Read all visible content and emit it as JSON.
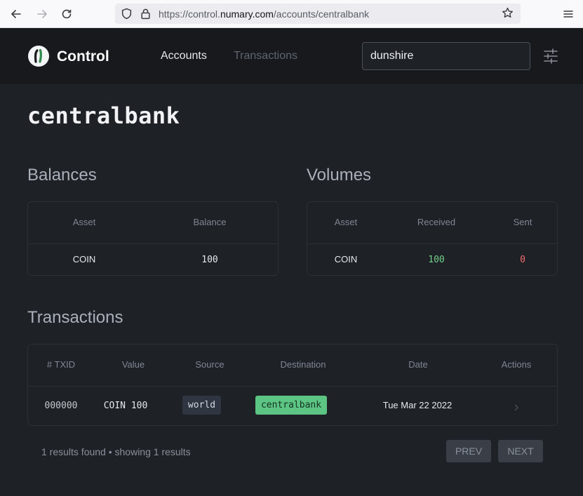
{
  "browser": {
    "url_prefix": "https://control.",
    "url_domain": "numary.com",
    "url_path": "/accounts/centralbank"
  },
  "header": {
    "brand": "Control",
    "nav": {
      "accounts": "Accounts",
      "transactions": "Transactions"
    },
    "search": {
      "value": "dunshire"
    }
  },
  "account": {
    "name": "centralbank"
  },
  "balances": {
    "title": "Balances",
    "columns": [
      "Asset",
      "Balance"
    ],
    "rows": [
      {
        "asset": "COIN",
        "balance": "100"
      }
    ]
  },
  "volumes": {
    "title": "Volumes",
    "columns": [
      "Asset",
      "Received",
      "Sent"
    ],
    "rows": [
      {
        "asset": "COIN",
        "received": "100",
        "sent": "0"
      }
    ]
  },
  "transactions": {
    "title": "Transactions",
    "columns": [
      "# TXID",
      "Value",
      "Source",
      "Destination",
      "Date",
      "Actions"
    ],
    "rows": [
      {
        "txid": "000000",
        "value": "COIN 100",
        "source": "world",
        "destination": "centralbank",
        "date": "Tue Mar 22 2022"
      }
    ],
    "footer": "1 results found • showing 1 results",
    "prev": "PREV",
    "next": "NEXT"
  },
  "colors": {
    "background": "#1e2126",
    "header": "#17191d",
    "received": "#6fd08a",
    "sent": "#f06b6b",
    "destination_tag": "#5cc584",
    "source_tag": "#2f3641"
  }
}
